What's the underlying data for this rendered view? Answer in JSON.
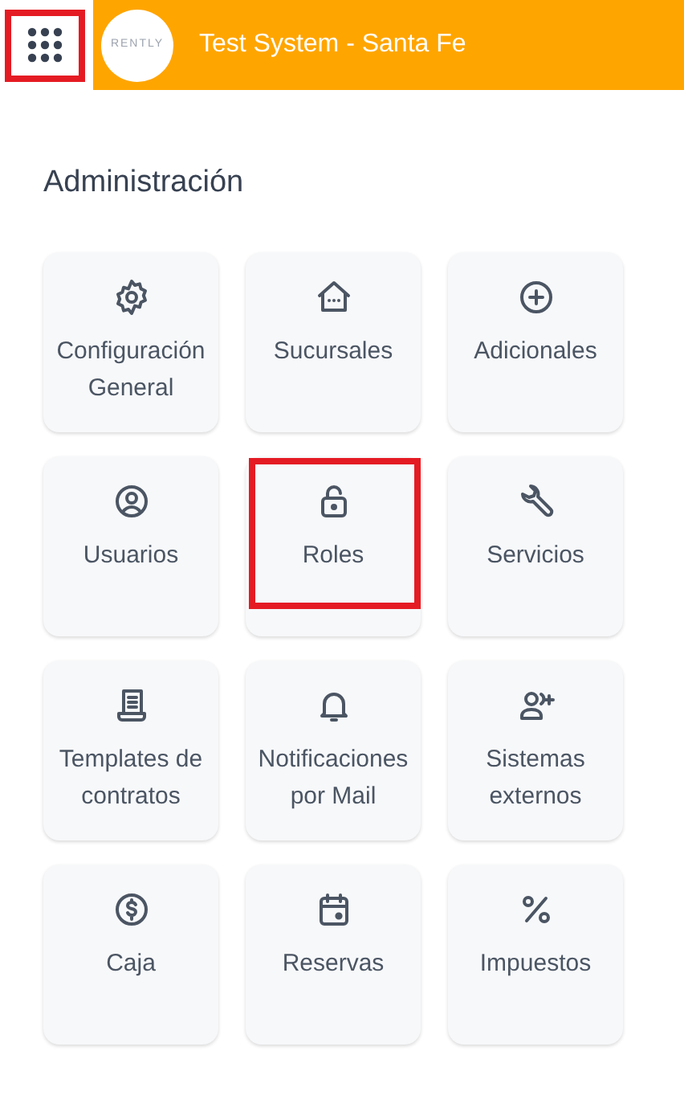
{
  "header": {
    "apps_button": {
      "highlighted": true
    },
    "logo": "RENTLY",
    "title": "Test System - Santa Fe"
  },
  "section_title": "Administración",
  "tiles": [
    {
      "kind": "gear",
      "label": "Configuración General",
      "highlighted": false
    },
    {
      "kind": "house",
      "label": "Sucursales",
      "highlighted": false
    },
    {
      "kind": "plus",
      "label": "Adicionales",
      "highlighted": false
    },
    {
      "kind": "user",
      "label": "Usuarios",
      "highlighted": false
    },
    {
      "kind": "lock",
      "label": "Roles",
      "highlighted": true
    },
    {
      "kind": "wrench",
      "label": "Servicios",
      "highlighted": false
    },
    {
      "kind": "document",
      "label": "Templates de contratos",
      "highlighted": false
    },
    {
      "kind": "bell",
      "label": "Notificaciones por Mail",
      "highlighted": false
    },
    {
      "kind": "person-add",
      "label": "Sistemas externos",
      "highlighted": false
    },
    {
      "kind": "dollar",
      "label": "Caja",
      "highlighted": false
    },
    {
      "kind": "calendar",
      "label": "Reservas",
      "highlighted": false
    },
    {
      "kind": "percent",
      "label": "Impuestos",
      "highlighted": false
    }
  ]
}
